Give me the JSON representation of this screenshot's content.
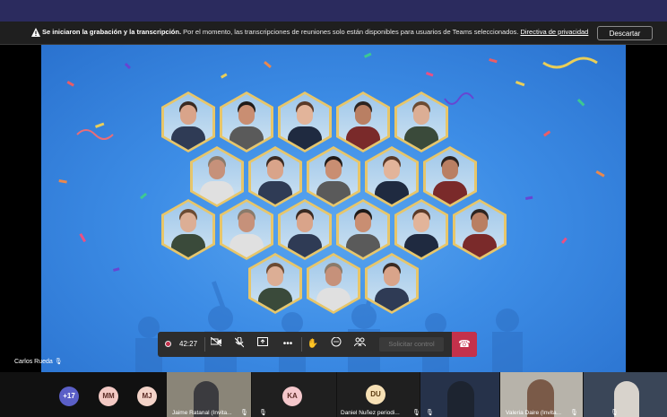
{
  "banner": {
    "bold_text": "Se iniciaron la grabación y la transcripción.",
    "message": " Por el momento, las transcripciones de reuniones solo están disponibles para usuarios de Teams seleccionados. ",
    "privacy_link": "Directiva de privacidad",
    "dismiss_label": "Descartar"
  },
  "presenter": {
    "name": "Carlos Rueda"
  },
  "controls": {
    "timer": "42:27",
    "request_control_label": "Solicitar control"
  },
  "participants": {
    "overflow_count": "+17",
    "avatars": [
      {
        "initials": "MM",
        "bg": "#f3c9c4",
        "fg": "#5a2a24"
      },
      {
        "initials": "MJ",
        "bg": "#f3d3c8",
        "fg": "#5a2a24"
      },
      {
        "initials": "KA",
        "bg": "#f5c8cc",
        "fg": "#5a2a24"
      },
      {
        "initials": "DU",
        "bg": "#f6e0b5",
        "fg": "#5a3a10"
      }
    ],
    "tiles": [
      {
        "name": "Jaime Ratanal (Invita..."
      },
      {
        "name": "Daniel Nuñez periodi..."
      },
      {
        "name": "Valeria Daire (Invita..."
      }
    ]
  },
  "colors": {
    "accent": "#2b2b5e",
    "record": "#c4314b",
    "hex_border": "#e7c66a"
  }
}
